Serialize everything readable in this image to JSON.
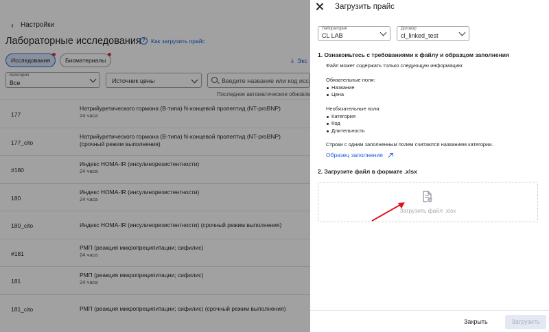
{
  "back": {
    "label": "Настройки"
  },
  "page": {
    "title": "Лабораторные исследования",
    "howto": "Как загрузить прайс",
    "chips": [
      "Исследования",
      "Биоматериалы"
    ],
    "export_label": "Экс",
    "filters": {
      "category_label": "Категория",
      "category_value": "Все",
      "price_source": "Источник цены",
      "search_placeholder": "Введите название или код исследования"
    },
    "auto_update": "Последнее автоматическое обновление"
  },
  "rows": [
    {
      "code": "177",
      "name": "Натрийуретического гормона (B-типа) N-концевой пропептид (NT-proBNP)",
      "duration": "24 часа"
    },
    {
      "code": "177_cito",
      "name": "Натрийуретического гормона (B-типа) N-концевой пропептид (NT-proBNP) (срочный режим выполнения)",
      "duration": ""
    },
    {
      "code": "#180",
      "name": "Индекс HOMA-IR (инсулинорезистентности)",
      "duration": "24 часа"
    },
    {
      "code": "180",
      "name": "Индекс HOMA-IR (инсулинорезистентности)",
      "duration": "24 часа"
    },
    {
      "code": "180_cito",
      "name": "Индекс HOMA-IR (инсулинорезистентности) (срочный режим выполнения)",
      "duration": ""
    },
    {
      "code": "#181",
      "name": "РМП (реакция микропреципитации; сифилис)",
      "duration": "24 часа"
    },
    {
      "code": "181",
      "name": "РМП (реакция микропреципитации; сифилис)",
      "duration": "24 часа"
    },
    {
      "code": "181_cito",
      "name": "РМП (реакция микропреципитации; сифилис) (срочный режим выполнения)",
      "duration": ""
    }
  ],
  "drawer": {
    "title": "Загрузить прайс",
    "lab_label": "Лаборатория",
    "lab_value": "CL LAB",
    "contract_label": "Договор",
    "contract_value": "cl_linked_test",
    "section1": "1. Ознакомьтесь с требованиями к файлу и образцом заполнения",
    "intro": "Файл может содержать только следующую информацию:",
    "required_title": "Обязательные поля:",
    "required": [
      "Название",
      "Цена"
    ],
    "optional_title": "Необязательные поля:",
    "optional": [
      "Категория",
      "Код",
      "Длительность"
    ],
    "note": "Строки с одним заполненным полем считаются названием категории.",
    "sample_link": "Образец заполнения",
    "section2": "2. Загрузите файл в формате .xlsx",
    "dropzone_text": "Загрузить файл .xlsx",
    "close_btn": "Закрыть",
    "upload_btn": "Загрузить"
  },
  "colors": {
    "accent": "#1f5fd6",
    "annotation_arrow": "#e0161c"
  }
}
